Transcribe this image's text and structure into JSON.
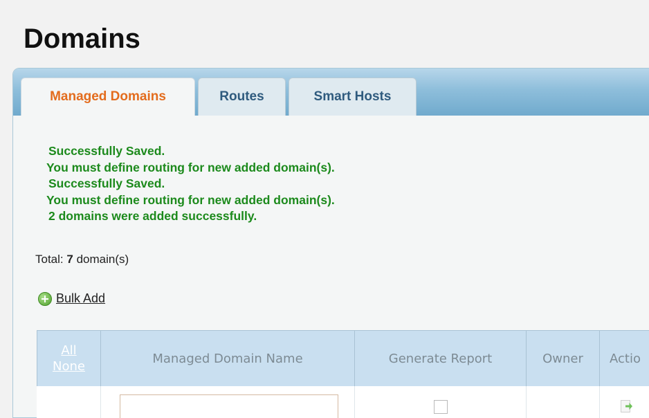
{
  "page": {
    "title": "Domains"
  },
  "tabs": [
    {
      "label": "Managed Domains",
      "active": true
    },
    {
      "label": "Routes",
      "active": false
    },
    {
      "label": "Smart Hosts",
      "active": false
    }
  ],
  "messages": [
    "Successfully Saved.",
    "You must define routing for new added domain(s).",
    "Successfully Saved.",
    "You must define routing for new added domain(s).",
    "2 domains were added successfully."
  ],
  "summary": {
    "prefix": "Total:",
    "count": "7",
    "suffix": "domain(s)"
  },
  "bulk_add": {
    "label": "Bulk Add",
    "icon": "add-circle-icon"
  },
  "table": {
    "select_all": "All",
    "select_none": "None",
    "columns": [
      "Managed Domain Name",
      "Generate Report",
      "Owner",
      "Actio"
    ]
  },
  "colors": {
    "accent_tab": "#e36c1d",
    "success_text": "#1c8a1c",
    "header_bg": "#c9dff0"
  }
}
